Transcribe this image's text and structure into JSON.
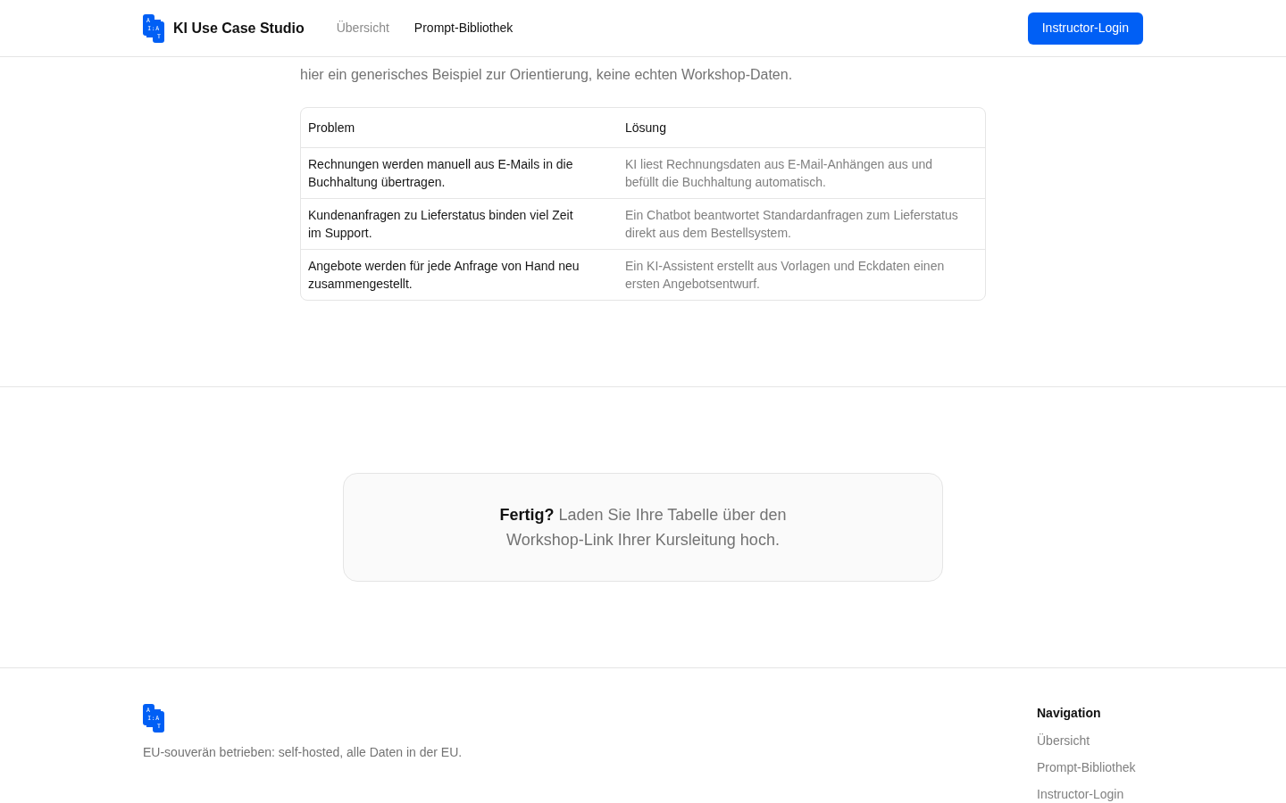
{
  "header": {
    "brand": {
      "logo_lines": [
        "A",
        "I:A",
        "T"
      ],
      "name": "KI Use Case Studio"
    },
    "nav": [
      {
        "label": "Übersicht",
        "selected": false
      },
      {
        "label": "Prompt-Bibliothek",
        "selected": true
      }
    ],
    "login_button": "Instructor-Login"
  },
  "intro": {
    "text": "hier ein generisches Beispiel zur Orientierung, keine echten Workshop-Daten."
  },
  "table": {
    "columns": [
      "Problem",
      "Lösung"
    ],
    "rows": [
      [
        "Rechnungen werden manuell aus E-Mails in die Buchhaltung übertragen.",
        "KI liest Rechnungsdaten aus E-Mail-Anhängen aus und befüllt die Buchhaltung automatisch."
      ],
      [
        "Kundenanfragen zu Lieferstatus binden viel Zeit im Support.",
        "Ein Chatbot beantwortet Standardanfragen zum Lieferstatus direkt aus dem Bestellsystem."
      ],
      [
        "Angebote werden für jede Anfrage von Hand neu zusammengestellt.",
        "Ein KI-Assistent erstellt aus Vorlagen und Eckdaten einen ersten Angebotsentwurf."
      ]
    ]
  },
  "cta": {
    "text": "**Fertig?** Laden Sie Ihre Tabelle über den Workshop-Link Ihrer Kursleitung hoch."
  },
  "footer": {
    "logo_lines": [
      "A",
      "I:A",
      "T"
    ],
    "tagline": "EU-souverän betrieben: self-hosted, alle Daten in der EU.",
    "nav_heading": "Navigation",
    "links": [
      "Übersicht",
      "Prompt-Bibliothek",
      "Instructor-Login"
    ]
  }
}
